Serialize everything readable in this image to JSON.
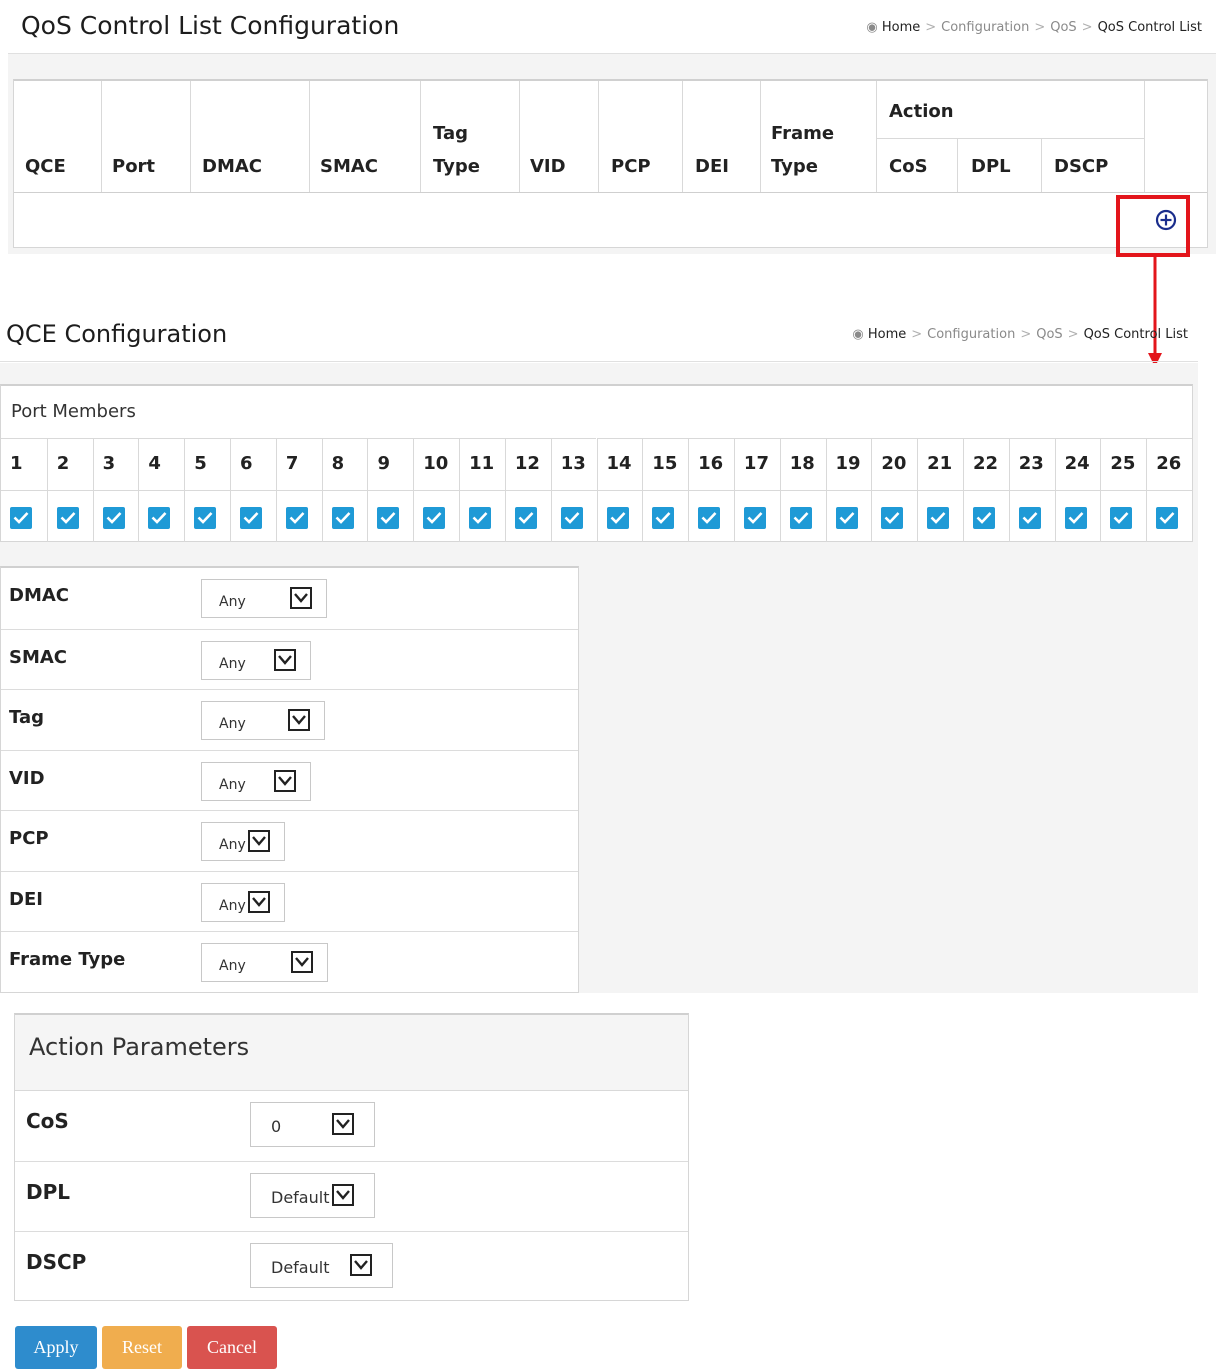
{
  "qcl_page": {
    "title": "QoS Control List Configuration",
    "breadcrumb": [
      "Home",
      "Configuration",
      "QoS",
      "QoS Control List"
    ],
    "table": {
      "columns": [
        "QCE",
        "Port",
        "DMAC",
        "SMAC",
        "Tag Type",
        "VID",
        "PCP",
        "DEI",
        "Frame Type"
      ],
      "action_group": "Action",
      "action_columns": [
        "CoS",
        "DPL",
        "DSCP"
      ],
      "rows": []
    },
    "add_icon": "plus-circle-icon",
    "highlight_color": "#e3151b"
  },
  "qce_page": {
    "title": "QCE Configuration",
    "breadcrumb": [
      "Home",
      "Configuration",
      "QoS",
      "QoS Control List"
    ],
    "port_members": {
      "title": "Port Members",
      "ports": [
        "1",
        "2",
        "3",
        "4",
        "5",
        "6",
        "7",
        "8",
        "9",
        "10",
        "11",
        "12",
        "13",
        "14",
        "15",
        "16",
        "17",
        "18",
        "19",
        "20",
        "21",
        "22",
        "23",
        "24",
        "25",
        "26"
      ],
      "all_checked": true
    },
    "rules": [
      {
        "label": "DMAC",
        "value": "Any"
      },
      {
        "label": "SMAC",
        "value": "Any"
      },
      {
        "label": "Tag",
        "value": "Any"
      },
      {
        "label": "VID",
        "value": "Any"
      },
      {
        "label": "PCP",
        "value": "Any"
      },
      {
        "label": "DEI",
        "value": "Any"
      },
      {
        "label": "Frame Type",
        "value": "Any"
      }
    ],
    "action_parameters": {
      "title": "Action Parameters",
      "fields": [
        {
          "label": "CoS",
          "value": "0"
        },
        {
          "label": "DPL",
          "value": "Default"
        },
        {
          "label": "DSCP",
          "value": "Default"
        }
      ]
    },
    "buttons": {
      "apply": "Apply",
      "reset": "Reset",
      "cancel": "Cancel"
    },
    "colors": {
      "checkbox": "#1f9ad6",
      "apply": "#2e8ccd",
      "reset": "#f0ad4e",
      "cancel": "#d9534f"
    }
  }
}
